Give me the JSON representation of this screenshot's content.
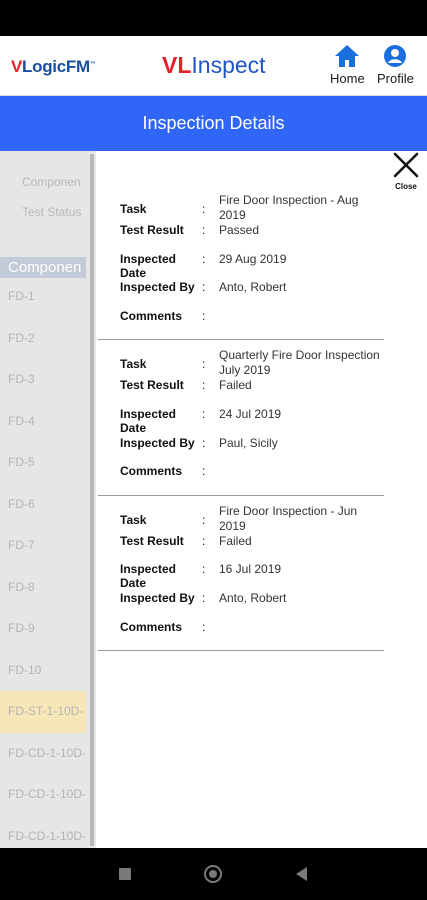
{
  "header": {
    "logo_left_v": "V",
    "logo_left_rest": "LogicFM",
    "logo_left_tm": "™",
    "logo_center_vl": "VL",
    "logo_center_rest": "Inspect",
    "home_label": "Home",
    "profile_label": "Profile"
  },
  "title": "Inspection Details",
  "background": {
    "component_label": "Componen",
    "test_status_label": "Test Status",
    "list_header": "Componen",
    "items": [
      "FD-1",
      "FD-2",
      "FD-3",
      "FD-4",
      "FD-5",
      "FD-6",
      "FD-7",
      "FD-8",
      "FD-9",
      "FD-10",
      "FD-ST-1-10D-",
      "FD-CD-1-10D-",
      "FD-CD-1-10D-",
      "FD-CD-1-10D-"
    ]
  },
  "detail": {
    "close_label": "Close",
    "labels": {
      "task": "Task",
      "test_result": "Test Result",
      "inspected_date": "Inspected Date",
      "inspected_by": "Inspected By",
      "comments": "Comments",
      "separator": ":"
    },
    "records": [
      {
        "task": "Fire Door Inspection - Aug 2019",
        "test_result": "Passed",
        "inspected_date": "29 Aug 2019",
        "inspected_by": "Anto, Robert",
        "comments": ""
      },
      {
        "task": "Quarterly Fire Door Inspection July 2019",
        "test_result": "Failed",
        "inspected_date": "24 Jul 2019",
        "inspected_by": "Paul, Sicily",
        "comments": ""
      },
      {
        "task": "Fire Door Inspection - Jun 2019",
        "test_result": "Failed",
        "inspected_date": "16 Jul 2019",
        "inspected_by": "Anto, Robert",
        "comments": ""
      }
    ]
  },
  "colors": {
    "accent": "#2f66f7",
    "highlight_row": "#f7e7b8",
    "brand_red": "#e8202a",
    "brand_blue": "#1f55c7"
  },
  "icons": {
    "home": "home-icon",
    "profile": "profile-icon",
    "close": "close-icon",
    "nav_recents": "recents-icon",
    "nav_home": "android-home-icon",
    "nav_back": "back-icon"
  }
}
